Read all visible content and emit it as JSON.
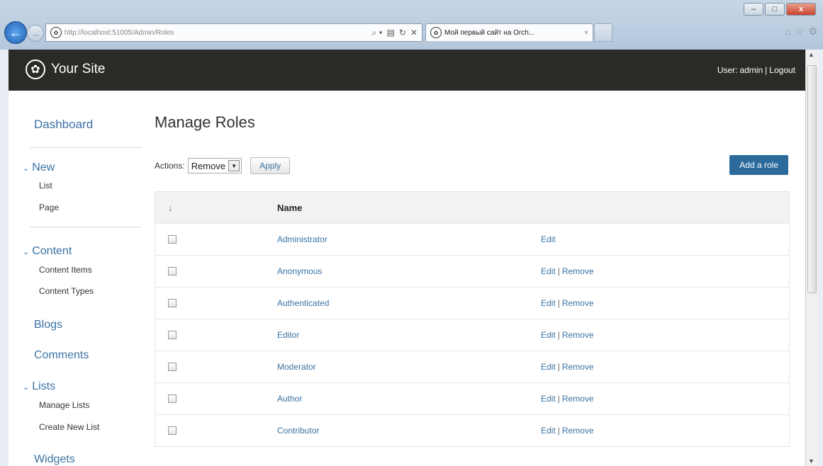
{
  "browser": {
    "window_controls": {
      "minimize": "–",
      "maximize": "□",
      "close": "x"
    },
    "back_glyph": "←",
    "forward_glyph": "→",
    "address": "http://localhost:51005/Admin/Roles",
    "address_tools": [
      "⌕ ▾",
      "▤",
      "↻",
      "✕"
    ],
    "tab_title": "Мой первый сайт на Orch...",
    "tab_close": "×",
    "toolbar_icons": [
      "⌂",
      "☆",
      "⚙"
    ]
  },
  "site": {
    "logo_glyph": "✿",
    "name": "Your Site",
    "user_label": "User:",
    "user_name": "admin",
    "separator": "|",
    "logout": "Logout"
  },
  "sidebar": {
    "dashboard": "Dashboard",
    "new": {
      "label": "New",
      "items": [
        "List",
        "Page"
      ]
    },
    "content": {
      "label": "Content",
      "items": [
        "Content Items",
        "Content Types"
      ]
    },
    "blogs": "Blogs",
    "comments": "Comments",
    "lists": {
      "label": "Lists",
      "items": [
        "Manage Lists",
        "Create New List"
      ]
    },
    "widgets": "Widgets"
  },
  "main": {
    "title": "Manage Roles",
    "actions_label": "Actions:",
    "actions_selected": "Remove",
    "apply_label": "Apply",
    "add_role_label": "Add a role",
    "table": {
      "header_check": "↓",
      "header_name": "Name",
      "rows": [
        {
          "name": "Administrator",
          "edit": "Edit",
          "remove": ""
        },
        {
          "name": "Anonymous",
          "edit": "Edit",
          "remove": "Remove"
        },
        {
          "name": "Authenticated",
          "edit": "Edit",
          "remove": "Remove"
        },
        {
          "name": "Editor",
          "edit": "Edit",
          "remove": "Remove"
        },
        {
          "name": "Moderator",
          "edit": "Edit",
          "remove": "Remove"
        },
        {
          "name": "Author",
          "edit": "Edit",
          "remove": "Remove"
        },
        {
          "name": "Contributor",
          "edit": "Edit",
          "remove": "Remove"
        }
      ]
    }
  },
  "colors": {
    "header_bg": "#2a2a26",
    "link": "#3b73a4",
    "button_primary": "#2b6a9a"
  }
}
